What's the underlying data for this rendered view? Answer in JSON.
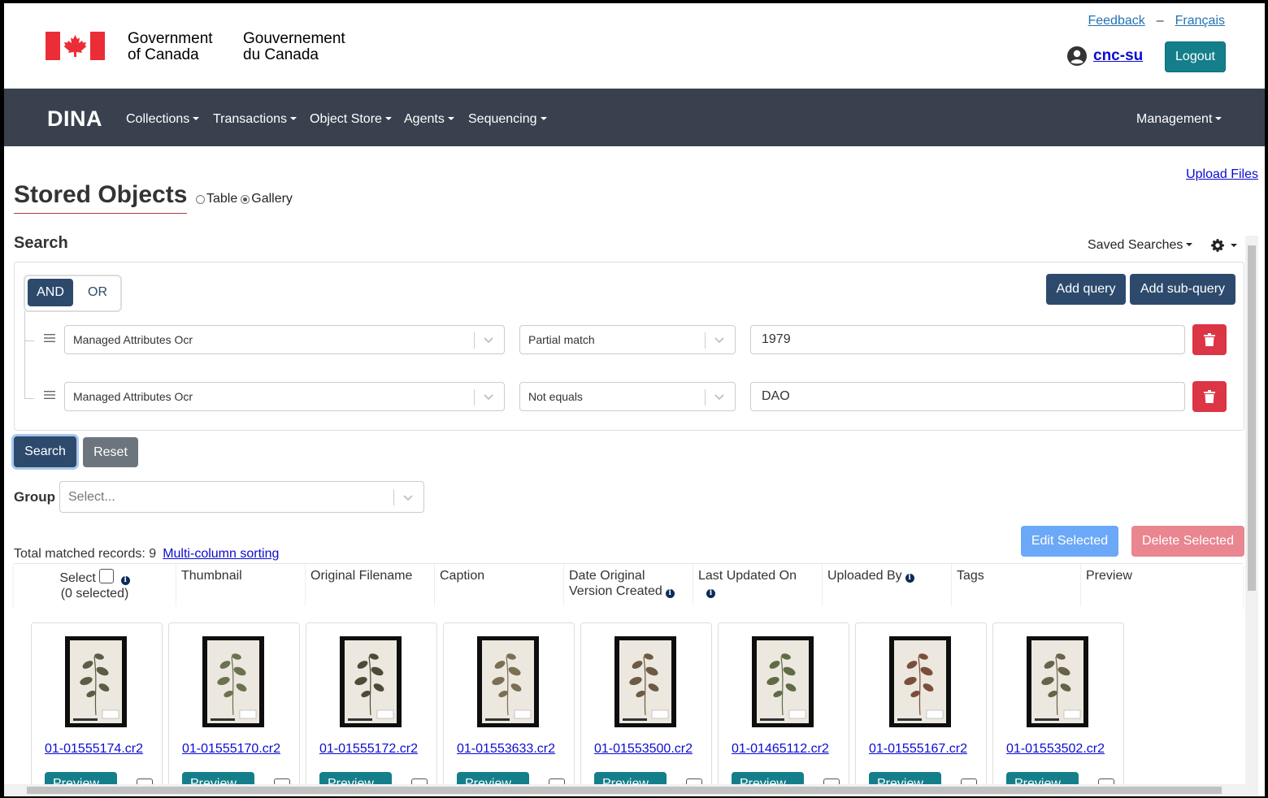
{
  "header": {
    "gov_en_line1": "Government",
    "gov_en_line2": "of Canada",
    "gov_fr_line1": "Gouvernement",
    "gov_fr_line2": "du Canada",
    "feedback": "Feedback",
    "separator": "–",
    "language": "Français",
    "username": "cnc-su",
    "logout": "Logout"
  },
  "navbar": {
    "brand": "DINA",
    "items": [
      "Collections",
      "Transactions",
      "Object Store",
      "Agents",
      "Sequencing"
    ],
    "right_item": "Management"
  },
  "page": {
    "title": "Stored Objects",
    "view_options": [
      "Table",
      "Gallery"
    ],
    "selected_view": "Gallery",
    "upload_link": "Upload Files"
  },
  "search": {
    "label": "Search",
    "saved_searches": "Saved Searches",
    "and_label": "AND",
    "or_label": "OR",
    "add_query": "Add query",
    "add_subquery": "Add sub-query",
    "rows": [
      {
        "field": "Managed Attributes Ocr",
        "operator": "Partial match",
        "value": "1979"
      },
      {
        "field": "Managed Attributes Ocr",
        "operator": "Not equals",
        "value": "DAO"
      }
    ],
    "search_button": "Search",
    "reset_button": "Reset"
  },
  "group": {
    "label": "Group",
    "placeholder": "Select..."
  },
  "results": {
    "total_label": "Total matched records: 9",
    "multi_sort_link": "Multi-column sorting",
    "edit_selected": "Edit Selected",
    "delete_selected": "Delete Selected",
    "select_label": "Select",
    "selected_count": "(0 selected)",
    "columns": [
      "Thumbnail",
      "Original Filename",
      "Caption",
      "Date Original Version Created",
      "Last Updated On",
      "Uploaded By",
      "Tags",
      "Preview"
    ],
    "cards": [
      {
        "filename": "01-01555174.cr2"
      },
      {
        "filename": "01-01555170.cr2"
      },
      {
        "filename": "01-01555172.cr2"
      },
      {
        "filename": "01-01553633.cr2"
      },
      {
        "filename": "01-01553500.cr2"
      },
      {
        "filename": "01-01465112.cr2"
      },
      {
        "filename": "01-01555167.cr2"
      },
      {
        "filename": "01-01553502.cr2"
      }
    ],
    "preview_button": "Preview"
  },
  "colors": {
    "navbar": "#38414d",
    "primary": "#2d4a6d",
    "teal": "#147f8a",
    "danger": "#dc3545",
    "flag_red": "#eb2d37"
  }
}
